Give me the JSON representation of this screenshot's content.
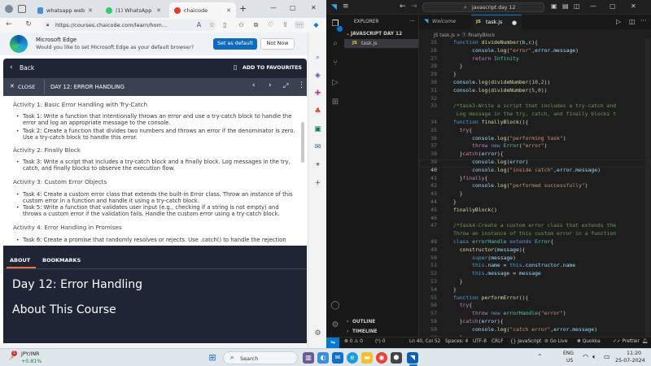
{
  "browser": {
    "tabs": [
      {
        "label": "whatsapp web"
      },
      {
        "label": "(1) WhatsApp"
      },
      {
        "label": "chaicode"
      }
    ],
    "new_tab": "+",
    "url": "https://courses.chaicode.com/learn/hom...",
    "banner": {
      "title": "Microsoft Edge",
      "message": "Would you like to set Microsoft Edge as your default browser?",
      "primary": "Set as default",
      "secondary": "Not Now"
    }
  },
  "course": {
    "back": "Back",
    "favourite": "ADD TO FAVOURITES",
    "close": "CLOSE",
    "lesson_title": "DAY 12: ERROR HANDLING",
    "activities": [
      {
        "heading": "Activity 1: Basic Error Handling with Try-Catch",
        "tasks": [
          [
            "Task 1: Write a function that intentionally throws an error and use a try-catch block to handle the",
            "error and log an appropriate message to the console."
          ],
          [
            "Task 2: Create a function that divides two numbers and throws an error if the denominator is zero.",
            "Use a try-catch block to handle this error."
          ]
        ]
      },
      {
        "heading": "Activity 2: Finally Block",
        "tasks": [
          [
            "Task 3: Write a script that includes a try-catch block and a finally block. Log messages in the try,",
            "catch, and finally blocks to observe the execution flow."
          ]
        ]
      },
      {
        "heading": "Activity 3: Custom Error Objects",
        "tasks": [
          [
            "Task 4: Create a custom error class that extends the built-in Error class. Throw an instance of this",
            "custom error in a function and handle it using a try-catch block."
          ],
          [
            "Task 5: Write a function that validates user input (e.g., checking if a string is not empty) and",
            "throws a custom error if the validation fails. Handle the custom error using a try-catch block."
          ]
        ]
      },
      {
        "heading": "Activity 4: Error Handling in Promises",
        "tasks": [
          [
            "Task 6: Create a promise that randomly resolves or rejects. Use .catch() to handle the rejection",
            ""
          ]
        ]
      }
    ],
    "tab_about": "ABOUT",
    "tab_bookmarks": "BOOKMARKS",
    "big_title": "Day 12: Error Handling",
    "about_heading": "About This Course"
  },
  "vscode": {
    "search": "javascript day 12",
    "explorer_label": "EXPLORER",
    "folder": "JAVASCRIPT DAY 12",
    "file": "task.js",
    "outline": "OUTLINE",
    "timeline": "TIMELINE",
    "tab_welcome": "Welcome",
    "tab_file": "task.js",
    "breadcrumb": "JS task.js > ⓕ finallyBlock",
    "lines": [
      {
        "n": "25",
        "t": "function divideNumber(b,c){"
      },
      {
        "n": "26",
        "t": "      console.log(\"error\",error.message)"
      },
      {
        "n": "27",
        "t": "      return Infinity"
      },
      {
        "n": "28",
        "t": "  }"
      },
      {
        "n": "29",
        "t": "}"
      },
      {
        "n": "30",
        "t": "console.log(divideNumber(10,2))"
      },
      {
        "n": "31",
        "t": "console.log(divideNumber(5,0))"
      },
      {
        "n": "32",
        "t": ""
      },
      {
        "n": "33",
        "t": "/*task3-Write a script that includes a try-catch and"
      },
      {
        "n": "",
        "t": " Log message in the try, catch, and finally blocks t"
      },
      {
        "n": "34",
        "t": "function finallyBlock(){"
      },
      {
        "n": "35",
        "t": "  try{"
      },
      {
        "n": "36",
        "t": "      console.log(\"performing task\")"
      },
      {
        "n": "37",
        "t": "      throw new Error(\"error\")"
      },
      {
        "n": "38",
        "t": "  }catch(error){"
      },
      {
        "n": "39",
        "t": "      console.log(error)"
      },
      {
        "n": "40",
        "t": "      console.log(\"inside catch\",error.message)"
      },
      {
        "n": "41",
        "t": "  }finally{"
      },
      {
        "n": "42",
        "t": "      console.log(\"performed successfully\")"
      },
      {
        "n": "43",
        "t": "  }"
      },
      {
        "n": "44",
        "t": "}"
      },
      {
        "n": "45",
        "t": "finallyBlock()"
      },
      {
        "n": "46",
        "t": ""
      },
      {
        "n": "47",
        "t": "/*task4-Create a custom error class that extends the"
      },
      {
        "n": "",
        "t": "Throw an instance of this custom error in a function"
      },
      {
        "n": "48",
        "t": "class errorHandle extends Error{"
      },
      {
        "n": "49",
        "t": "  constructor(message){"
      },
      {
        "n": "50",
        "t": "      super(message)"
      },
      {
        "n": "51",
        "t": "      this.name = this.constructor.name"
      },
      {
        "n": "52",
        "t": "      this.message = message"
      },
      {
        "n": "53",
        "t": "  }"
      },
      {
        "n": "54",
        "t": "}"
      },
      {
        "n": "55",
        "t": "function performError(){"
      },
      {
        "n": "56",
        "t": "  try{"
      },
      {
        "n": "57",
        "t": "      throw new errorHandle(\"error\")"
      },
      {
        "n": "58",
        "t": "  }catch(error){"
      },
      {
        "n": "59",
        "t": "      console.log(\"catch error\",error.message)"
      },
      {
        "n": "60",
        "t": "  }"
      },
      {
        "n": "61",
        "t": "}"
      }
    ],
    "status": {
      "errors": "⊗ 0 ⚠ 0",
      "ports": "(ᵒ) 0",
      "position": "Ln 40, Col 52",
      "spaces": "Spaces: 4",
      "encoding": "UTF-8",
      "eol": "CRLF",
      "language": "{} JavaScript",
      "golive": "⊘ Go Live",
      "quokka": "❋ Quokka",
      "prettier": "✓✓ Prettier"
    }
  },
  "taskbar": {
    "stock_name": "JPY/INR",
    "stock_change": "+0.81%",
    "search": "Search",
    "lang1": "ENG",
    "lang2": "US",
    "time": "11:20",
    "date": "25-07-2024",
    "notif_badge": "1"
  },
  "colors": {
    "keyword": "#c586c0",
    "func": "#dcdcaa",
    "string": "#ce9178",
    "number": "#b5cea8",
    "comment": "#6a9955",
    "var": "#9cdcfe",
    "storage": "#569cd6",
    "plain": "#d4d4d4",
    "accent_blue": "#0078d4",
    "orange": "#e8743b"
  }
}
